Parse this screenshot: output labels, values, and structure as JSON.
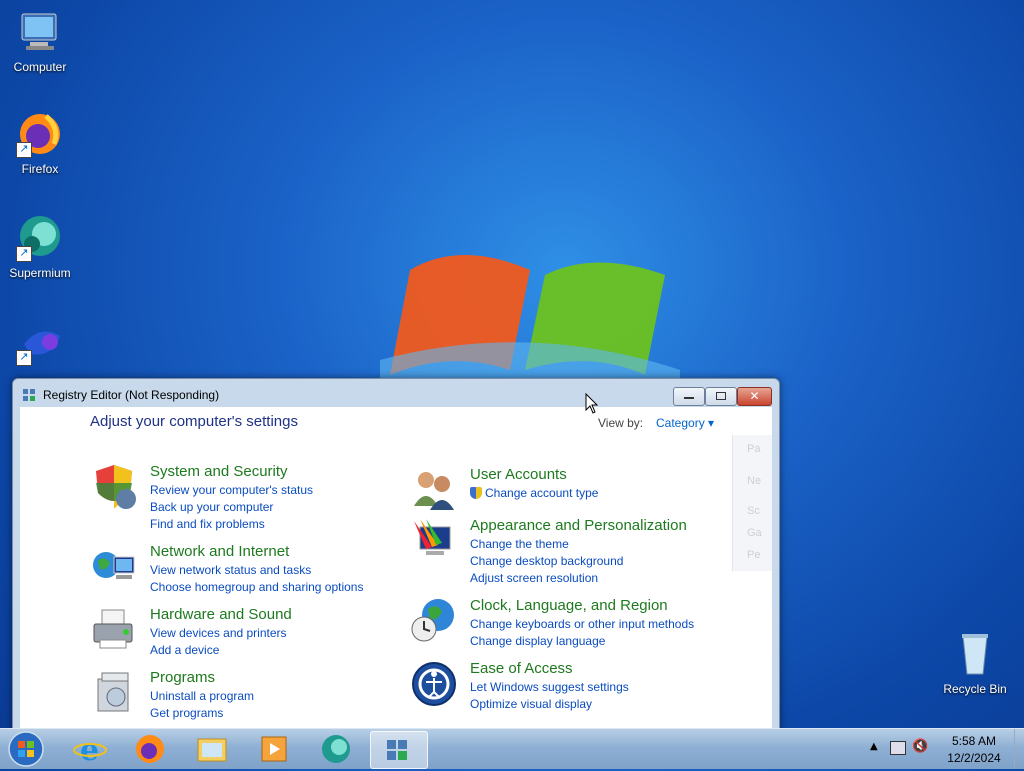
{
  "desktop": {
    "icons": [
      {
        "label": "Computer",
        "icon": "computer-icon"
      },
      {
        "label": "Firefox",
        "icon": "firefox-icon"
      },
      {
        "label": "Supermium",
        "icon": "supermium-icon"
      },
      {
        "label": "",
        "icon": "app-shortcut-icon"
      },
      {
        "label": "Recycle Bin",
        "icon": "recycle-bin-icon"
      }
    ]
  },
  "window": {
    "title": "Registry Editor (Not Responding)",
    "header": "Adjust your computer's settings",
    "view_by_label": "View by:",
    "view_by_value": "Category",
    "ghost_menu": [
      "Pa",
      "Ne",
      "Sc",
      "Ga",
      "Pe"
    ],
    "categories_left": [
      {
        "title": "System and Security",
        "icon": "shield-icon",
        "links": [
          "Review your computer's status",
          "Back up your computer",
          "Find and fix problems"
        ]
      },
      {
        "title": "Network and Internet",
        "icon": "network-icon",
        "links": [
          "View network status and tasks",
          "Choose homegroup and sharing options"
        ]
      },
      {
        "title": "Hardware and Sound",
        "icon": "printer-icon",
        "links": [
          "View devices and printers",
          "Add a device"
        ]
      },
      {
        "title": "Programs",
        "icon": "programs-icon",
        "links": [
          "Uninstall a program",
          "Get programs"
        ]
      }
    ],
    "categories_right": [
      {
        "title": "User Accounts",
        "icon": "users-icon",
        "links": [
          "Change account type"
        ]
      },
      {
        "title": "Appearance and Personalization",
        "icon": "appearance-icon",
        "links": [
          "Change the theme",
          "Change desktop background",
          "Adjust screen resolution"
        ]
      },
      {
        "title": "Clock, Language, and Region",
        "icon": "clock-globe-icon",
        "links": [
          "Change keyboards or other input methods",
          "Change display language"
        ]
      },
      {
        "title": "Ease of Access",
        "icon": "ease-of-access-icon",
        "links": [
          "Let Windows suggest settings",
          "Optimize visual display"
        ]
      }
    ]
  },
  "taskbar": {
    "items": [
      "start-button",
      "internet-explorer",
      "firefox",
      "file-explorer",
      "media-player",
      "supermium",
      "registry-editor"
    ],
    "time": "5:58 AM",
    "date": "12/2/2024"
  },
  "colors": {
    "category_title": "#1e7a1e",
    "link": "#0a4cc0",
    "header": "#1e3287"
  }
}
